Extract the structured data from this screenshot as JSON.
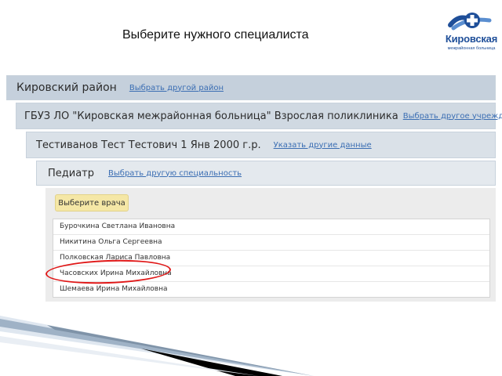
{
  "page_title": "Выберите нужного специалиста",
  "logo": {
    "name": "Кировская",
    "subtitle": "межрайонная больница",
    "colors": {
      "primary": "#1f4f99",
      "secondary": "#5a8ed0"
    }
  },
  "breadcrumbs": [
    {
      "label": "Кировский район",
      "link": "Выбрать другой район"
    },
    {
      "label": "ГБУЗ ЛО \"Кировская межрайонная больница\" Взрослая поликлиника",
      "link": "Выбрать другое учреждение"
    },
    {
      "label": "Тестиванов Тест Тестович 1 Янв 2000 г.р.",
      "link": "Указать другие данные"
    },
    {
      "label": "Педиатр",
      "link": "Выбрать другую специальность"
    }
  ],
  "choose_doctor_label": "Выберите врача",
  "doctors": [
    "Бурочкина Светлана Ивановна",
    "Никитина Ольга Сергеевна",
    "Полковская Лариса Павловна",
    "Часовских Ирина Михайловна",
    "Шемаева Ирина Михайловна"
  ],
  "highlighted_doctor_index": 3,
  "colors": {
    "link": "#3b6eb3",
    "highlight_ellipse": "#e01818",
    "choose_button_bg": "#f5e7a6"
  }
}
